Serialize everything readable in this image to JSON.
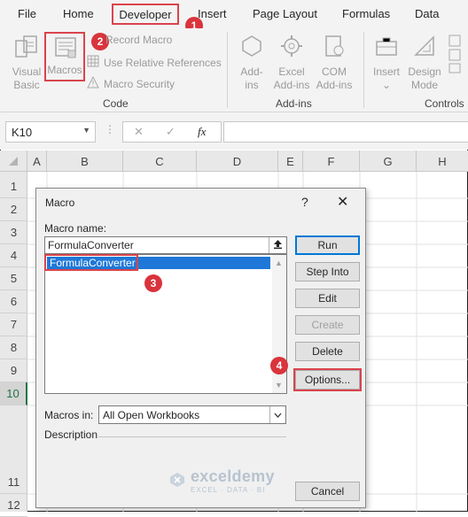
{
  "tabs": [
    "File",
    "Home",
    "Developer",
    "Insert",
    "Page Layout",
    "Formulas",
    "Data"
  ],
  "ribbon": {
    "code": {
      "visual_basic": [
        "Visual",
        "Basic"
      ],
      "macros": "Macros",
      "record_macro": "Record Macro",
      "use_relative": "Use Relative References",
      "macro_security": "Macro Security",
      "title": "Code"
    },
    "addins": {
      "addins": [
        "Add-",
        "ins"
      ],
      "excel_addins": [
        "Excel",
        "Add-ins"
      ],
      "com_addins": [
        "COM",
        "Add-ins"
      ],
      "title": "Add-ins"
    },
    "controls": {
      "insert": "Insert",
      "design_mode": [
        "Design",
        "Mode"
      ],
      "title": "Controls"
    }
  },
  "formula_bar": {
    "name_box": "K10",
    "fx": "fx",
    "formula": ""
  },
  "columns": [
    "A",
    "B",
    "C",
    "D",
    "E",
    "F",
    "G",
    "H"
  ],
  "rows": [
    "1",
    "2",
    "3",
    "4",
    "5",
    "6",
    "7",
    "8",
    "9",
    "10",
    "11",
    "12"
  ],
  "selected_row": "10",
  "dialog": {
    "title": "Macro",
    "help": "?",
    "close": "✕",
    "macro_name_label": "Macro name:",
    "macro_name_value": "FormulaConverter",
    "list": [
      "FormulaConverter"
    ],
    "macros_in_label": "Macros in:",
    "macros_in_value": "All Open Workbooks",
    "description_label": "Description",
    "buttons": {
      "run": "Run",
      "step_into": "Step Into",
      "edit": "Edit",
      "create": "Create",
      "delete": "Delete",
      "options": "Options...",
      "cancel": "Cancel"
    }
  },
  "badges": [
    "1",
    "2",
    "3",
    "4"
  ],
  "watermark": {
    "name": "exceldemy",
    "tagline": "EXCEL · DATA · BI"
  },
  "colors": {
    "accent_red": "#d9444c",
    "badge_red": "#d9343c",
    "selection_blue": "#1f78d7",
    "excel_green": "#217346"
  }
}
